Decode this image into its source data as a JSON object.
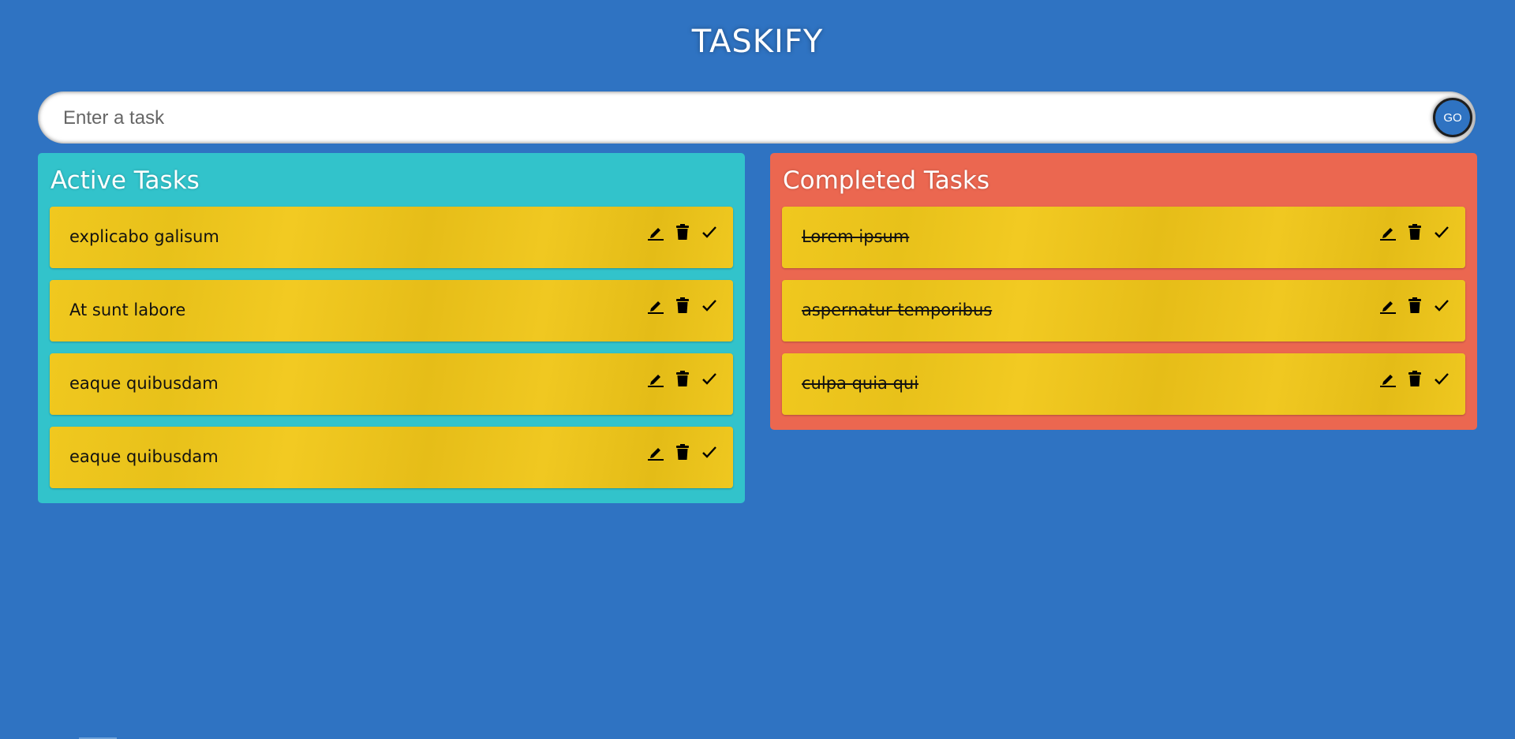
{
  "app": {
    "title": "TASKIFY"
  },
  "input": {
    "placeholder": "Enter a task",
    "value": "",
    "go_label": "GO"
  },
  "colors": {
    "background": "#2f73c2",
    "active_panel": "#32c3cb",
    "completed_panel": "#eb6750",
    "card": "#f0c81f"
  },
  "active": {
    "title": "Active Tasks",
    "tasks": [
      {
        "text": "explicabo galisum"
      },
      {
        "text": "At sunt labore"
      },
      {
        "text": "eaque quibusdam"
      },
      {
        "text": "eaque quibusdam"
      }
    ]
  },
  "completed": {
    "title": "Completed Tasks",
    "tasks": [
      {
        "text": "Lorem ipsum"
      },
      {
        "text": "aspernatur temporibus"
      },
      {
        "text": "culpa quia qui"
      }
    ]
  },
  "icons": {
    "edit": "pencil-icon",
    "delete": "trash-icon",
    "done": "check-icon"
  }
}
